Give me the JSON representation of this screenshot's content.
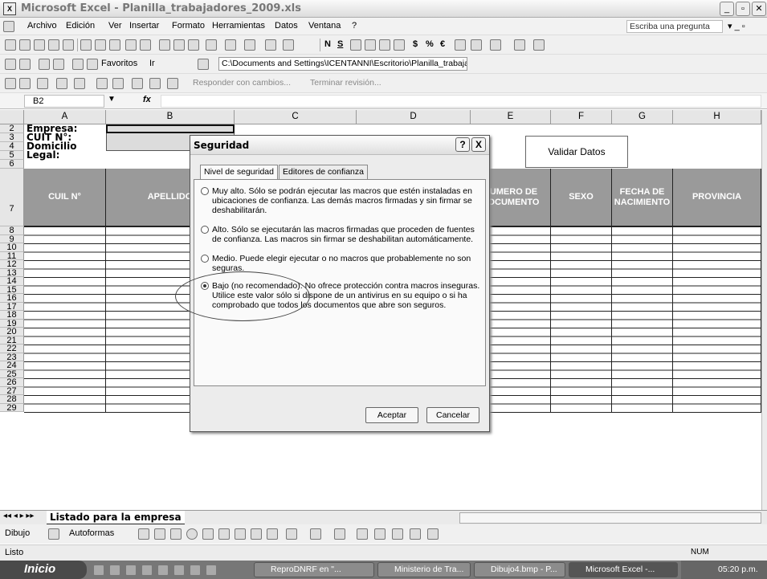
{
  "window": {
    "title": "Microsoft Excel - Planilla_trabajadores_2009.xls",
    "app_icon": "X"
  },
  "menubar": {
    "items": [
      "Archivo",
      "Edición",
      "Ver",
      "Insertar",
      "Formato",
      "Herramientas",
      "Datos",
      "Ventana",
      "?"
    ],
    "help_placeholder": "Escriba una pregunta"
  },
  "toolbar_format": {
    "bold": "N",
    "underline": "S",
    "currency": "$",
    "percent": "%",
    "euro": "€"
  },
  "web_toolbar": {
    "favoritos": "Favoritos",
    "ir": "Ir",
    "address": "C:\\Documents and Settings\\ICENTANNI\\Escritorio\\Planilla_trabajad"
  },
  "review_toolbar": {
    "responder": "Responder con cambios...",
    "terminar": "Terminar revisión..."
  },
  "formula_bar": {
    "name_box": "B2",
    "fx": "fx"
  },
  "grid": {
    "columns": [
      "A",
      "B",
      "C",
      "D",
      "E",
      "F",
      "G",
      "H"
    ],
    "rows": [
      "2",
      "3",
      "4",
      "5",
      "6",
      "7",
      "8",
      "9",
      "10",
      "11",
      "12",
      "13",
      "14",
      "15",
      "16",
      "17",
      "18",
      "19",
      "20",
      "21",
      "22",
      "23",
      "24",
      "25",
      "26",
      "27",
      "28",
      "29"
    ],
    "labels": {
      "empresa": "Empresa:",
      "cuit": "CUIT N°:",
      "domicilio": "Domicilio Legal:"
    },
    "headers": {
      "cuil": "CUIL N°",
      "apellido": "APELLIDO",
      "numero_doc": "NUMERO DE DOCUMENTO",
      "sexo": "SEXO",
      "fecha_nac": "FECHA DE NACIMIENTO",
      "provincia": "PROVINCIA"
    }
  },
  "validar_button": "Validar Datos",
  "sheet_tab": "Listado para la empresa",
  "drawing_toolbar": {
    "dibujo": "Dibujo",
    "autoformas": "Autoformas"
  },
  "status": {
    "left": "Listo",
    "num": "NUM"
  },
  "dialog": {
    "title": "Seguridad",
    "help_btn": "?",
    "close_btn": "X",
    "tabs": [
      "Nivel de seguridad",
      "Editores de confianza"
    ],
    "options": [
      {
        "label": "Muy alto. Sólo se podrán ejecutar las macros que estén instaladas en ubicaciones de confianza. Las demás macros firmadas y sin firmar se deshabilitarán.",
        "checked": false
      },
      {
        "label": "Alto. Sólo se ejecutarán las macros firmadas que proceden de fuentes de confianza. Las macros sin firmar se deshabilitan automáticamente.",
        "checked": false
      },
      {
        "label": "Medio. Puede elegir ejecutar o no macros que probablemente no son seguras.",
        "checked": false
      },
      {
        "label": "Bajo (no recomendado). No ofrece protección contra macros inseguras. Utilice este valor sólo si dispone de un antivirus en su equipo o si ha comprobado que todos los documentos que abre son seguros.",
        "checked": true
      }
    ],
    "ok": "Aceptar",
    "cancel": "Cancelar"
  },
  "taskbar": {
    "start": "Inicio",
    "tasks": [
      "ReproDNRF en \"...",
      "Ministerio de Tra...",
      "Dibujo4.bmp - P...",
      "Microsoft Excel -..."
    ],
    "clock": "05:20 p.m."
  }
}
